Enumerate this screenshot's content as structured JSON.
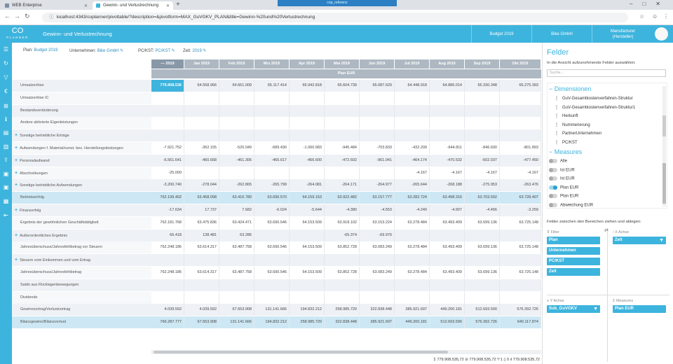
{
  "browser": {
    "tabs": [
      {
        "title": "WEB Enterprise"
      },
      {
        "title": "Gewinn- und Verlustrechnung"
      }
    ],
    "overlay_tab": "cop_referenz",
    "url": "localhost:4343/coplanner/pivottable/?description=&pivotform=MAX_GuVGKV_PLAN&title=Gewinn-%20und%20Verlustrechnung"
  },
  "app": {
    "logo_mark": "CO",
    "logo_text": "PLANNER",
    "title": "Gewinn- und Verlustrechnung",
    "budget": "Budget 2019",
    "company": "Bike GmbH",
    "role_line1": "Manufacturer",
    "role_line2": "(Hersteller)"
  },
  "filters": {
    "plan_label": "Plan:",
    "plan_value": "Budget 2019",
    "unternehmen_label": "Unternehmen:",
    "unternehmen_value": "Bike GmbH",
    "pc_label": "PC/KST:",
    "pc_value": "PC/KST",
    "zeit_label": "Zeit:",
    "zeit_value": "2019"
  },
  "pivot": {
    "columns": [
      "— 2019",
      "Jan 2019",
      "Feb 2019",
      "Mrz 2019",
      "Apr 2019",
      "Mai 2019",
      "Jun 2019",
      "Jul 2019",
      "Aug 2019",
      "Sep 2019",
      "Okt 2019"
    ],
    "measure": "Plan EUR",
    "rows": [
      {
        "label": "Umsatzerlöse",
        "exp": false,
        "values": [
          "779.908.536",
          "64.558.966",
          "64.661.009",
          "65.117.414",
          "65.942.818",
          "65.604.739",
          "65.087.629",
          "64.448.918",
          "64.886.014",
          "65.330.348",
          "65.275.393"
        ]
      },
      {
        "label": "Umsatzerlöse IC",
        "exp": false,
        "values": [
          "",
          "",
          "",
          "",
          "",
          "",
          "",
          "",
          "",
          "",
          ""
        ]
      },
      {
        "label": "Bestandsveränderung",
        "exp": false,
        "values": [
          "",
          "",
          "",
          "",
          "",
          "",
          "",
          "",
          "",
          "",
          ""
        ]
      },
      {
        "label": "Andere aktivierte Eigenleistungen",
        "exp": false,
        "values": [
          "",
          "",
          "",
          "",
          "",
          "",
          "",
          "",
          "",
          "",
          ""
        ]
      },
      {
        "label": "Sonstige betriebliche Erträge",
        "exp": true,
        "values": [
          "",
          "",
          "",
          "",
          "",
          "",
          "",
          "",
          "",
          "",
          ""
        ]
      },
      {
        "label": "Aufwendungen f. Material/sonst. bez. Herstellungsleistungen",
        "exp": true,
        "values": [
          "-7.921.752",
          "-362.155",
          "-520.049",
          "-689.430",
          "-1.060.983",
          "-945.484",
          "-703.833",
          "-432.209",
          "-644.811",
          "-846.600",
          "-801.893"
        ]
      },
      {
        "label": "Personalaufwand",
        "exp": true,
        "values": [
          "-6.561.641",
          "-460.668",
          "-461.306",
          "-465.617",
          "-456.600",
          "-472.602",
          "-961.041",
          "-464.174",
          "-470.532",
          "-502.037",
          "-477.450"
        ]
      },
      {
        "label": "Abschreibungen",
        "exp": true,
        "values": [
          "-25.000",
          "",
          "",
          "",
          "",
          "",
          "",
          "-4.167",
          "-4.167",
          "-4.167",
          "-4.167"
        ]
      },
      {
        "label": "Sonstige betriebliche Aufwendungen",
        "exp": true,
        "values": [
          "-3.200.740",
          "-278.044",
          "-262.865",
          "-265.799",
          "-264.081",
          "-264.171",
          "-264.977",
          "-265.644",
          "-268.188",
          "-275.953",
          "-263.476"
        ]
      },
      {
        "label": "Betriebserfolg",
        "exp": false,
        "hl": true,
        "values": [
          "762.199.402",
          "63.458.098",
          "63.416.789",
          "63.696.570",
          "64.159.153",
          "63.922.482",
          "63.157.777",
          "63.282.724",
          "63.498.316",
          "63.703.592",
          "63.728.407"
        ]
      },
      {
        "label": "Finanzerfolg",
        "exp": true,
        "values": [
          "-17.634",
          "17.737",
          "7.682",
          "-6.024",
          "-5.644",
          "-4.380",
          "-4.553",
          "-4.240",
          "-4.907",
          "-4.456",
          "-3.259"
        ]
      },
      {
        "label": "Ergebnis der gewöhnlichen Geschäftstätigkeit",
        "exp": false,
        "values": [
          "762.181.768",
          "63.475.836",
          "63.424.471",
          "63.690.546",
          "64.153.509",
          "63.918.102",
          "63.153.224",
          "63.278.484",
          "63.493.409",
          "63.699.136",
          "63.725.148"
        ]
      },
      {
        "label": "Außerordentliches Ergebnis",
        "exp": true,
        "values": [
          "66.418",
          "138.481",
          "63.286",
          "",
          "",
          "-65.374",
          "-69.976",
          "",
          "",
          "",
          ""
        ]
      },
      {
        "label": "Jahresüberschuss/Jahresfehlbetrag vor Steuern",
        "exp": false,
        "values": [
          "762.248.186",
          "63.614.317",
          "63.487.758",
          "63.690.546",
          "64.153.509",
          "63.852.728",
          "63.083.249",
          "63.278.484",
          "63.493.409",
          "63.699.136",
          "63.725.148"
        ]
      },
      {
        "label": "Steuern vom Einkommen und vom Ertrag",
        "exp": true,
        "values": [
          "",
          "",
          "",
          "",
          "",
          "",
          "",
          "",
          "",
          "",
          ""
        ]
      },
      {
        "label": "Jahresüberschuss/Jahresfehlbetrag",
        "exp": false,
        "values": [
          "762.248.186",
          "63.614.317",
          "63.487.758",
          "63.690.546",
          "64.153.509",
          "63.852.728",
          "63.083.249",
          "63.278.484",
          "63.493.409",
          "63.699.136",
          "63.725.148"
        ]
      },
      {
        "label": "Saldo aus Rücklagenbewegungen",
        "exp": false,
        "values": [
          "",
          "",
          "",
          "",
          "",
          "",
          "",
          "",
          "",
          "",
          ""
        ]
      },
      {
        "label": "Dividende",
        "exp": false,
        "values": [
          "",
          "",
          "",
          "",
          "",
          "",
          "",
          "",
          "",
          "",
          ""
        ]
      },
      {
        "label": "Gewinnvortrag/Verlustvortrag",
        "exp": false,
        "values": [
          "4.039.592",
          "4.039.592",
          "67.653.908",
          "131.141.666",
          "194.832.212",
          "258.985.720",
          "322.838.448",
          "385.921.697",
          "449.200.181",
          "512.693.590",
          "576.392.726"
        ]
      },
      {
        "label": "Bilanzgewinn/Bilanzverlust",
        "exp": false,
        "hl": true,
        "values": [
          "766.287.777",
          "67.653.908",
          "131.141.666",
          "194.832.212",
          "258.985.720",
          "322.838.448",
          "385.921.697",
          "449.200.181",
          "512.693.590",
          "576.392.726",
          "640.117.874"
        ]
      }
    ]
  },
  "status": {
    "text": "Σ 779.908.535,72  ⊘ 779.908.535,72  ⅟ 1  ▯ 0  ıl 779.908.535,72"
  },
  "fields": {
    "title": "Felder",
    "subtitle": "In die Ansicht aufzunehmende Felder auswählen:",
    "search_placeholder": "Suche...",
    "dim_group": "Dimensionen",
    "dimensions": [
      "GuV-Gesamtkostenverfahren-Struktur",
      "GuV-Gesamtkostenverfahren-Struktur1",
      "Herkunft",
      "Nummerierung",
      "PartnerUnternehmen",
      "PC/KST"
    ],
    "meas_group": "Measures",
    "measures": [
      {
        "label": "Alle",
        "on": false
      },
      {
        "label": "Ist EUR",
        "on": false
      },
      {
        "label": "Ist EUR",
        "on": false
      },
      {
        "label": "Plan EUR",
        "on": true
      },
      {
        "label": "Plan EUR",
        "on": false
      },
      {
        "label": "Abweichung EUR",
        "on": false
      }
    ],
    "drag_hint": "Felder zwischen den Bereichen ziehen und ablegen:",
    "filter_area": "Filter",
    "filter_chips": [
      "Plan",
      "Unternehmen",
      "PC/KST",
      "Zeit"
    ],
    "xaxis_area": "X Achse",
    "xaxis_chips": [
      "Zeit"
    ],
    "yaxis_area": "Y Achse",
    "yaxis_chips": [
      "Sub_GuVGKV"
    ],
    "measures_area": "Measures",
    "measures_chips": [
      "Plan EUR"
    ]
  }
}
